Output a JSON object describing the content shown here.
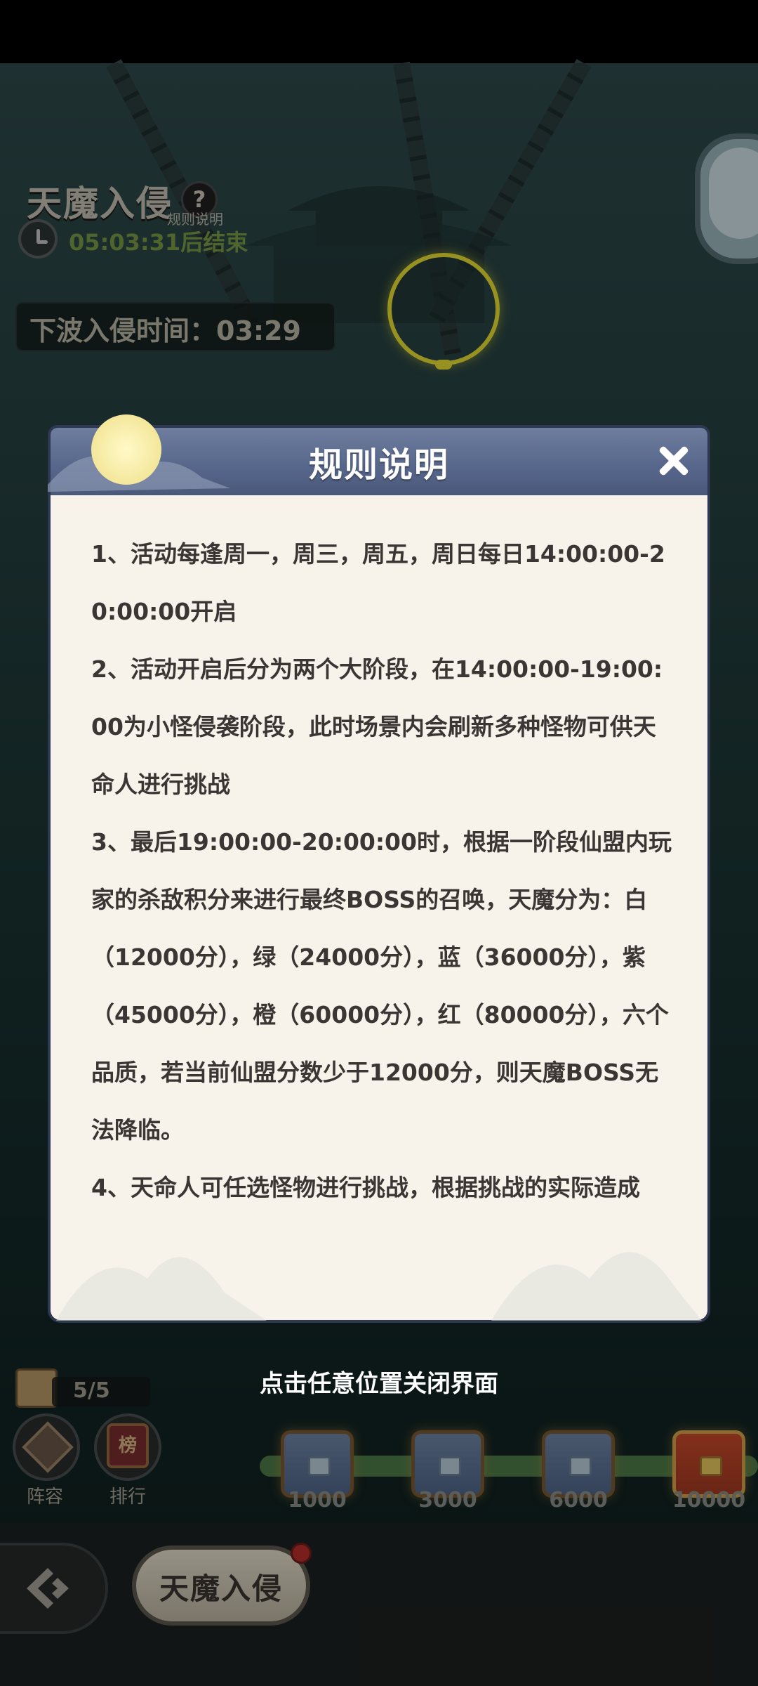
{
  "game": {
    "event_title": "天魔入侵",
    "help_label": "规则说明",
    "event_timer": "05:03:31后结束",
    "next_wave_label": "下波入侵时间：03:29"
  },
  "dialog": {
    "title": "规则说明",
    "rules": [
      "1、活动每逢周一，周三，周五，周日每日14:00:00-20:00:00开启",
      "2、活动开启后分为两个大阶段，在14:00:00-19:00:00为小怪侵袭阶段，此时场景内会刷新多种怪物可供天命人进行挑战",
      "3、最后19:00:00-20:00:00时，根据一阶段仙盟内玩家的杀敌积分来进行最终BOSS的召唤，天魔分为：白（12000分），绿（24000分），蓝（36000分），紫（45000分），橙（60000分），红（80000分），六个品质，若当前仙盟分数少于12000分，则天魔BOSS无法降临。",
      "4、天命人可任选怪物进行挑战，根据挑战的实际造成"
    ],
    "close_hint": "点击任意位置关闭界面"
  },
  "bottom": {
    "attempts": "5/5",
    "lineup_label": "阵容",
    "rank_label": "排行",
    "rank_glyph": "榜",
    "chests": [
      {
        "label": "1000",
        "type": "blue"
      },
      {
        "label": "3000",
        "type": "blue"
      },
      {
        "label": "6000",
        "type": "blue"
      },
      {
        "label": "10000",
        "type": "gold"
      }
    ],
    "progress_fraction": 1.0,
    "tab_label": "天魔入侵"
  },
  "colors": {
    "dialog_header": "#56668a",
    "dialog_body": "#f7f3ea",
    "ring": "#e9df33",
    "timer_green": "#7b9b45"
  }
}
